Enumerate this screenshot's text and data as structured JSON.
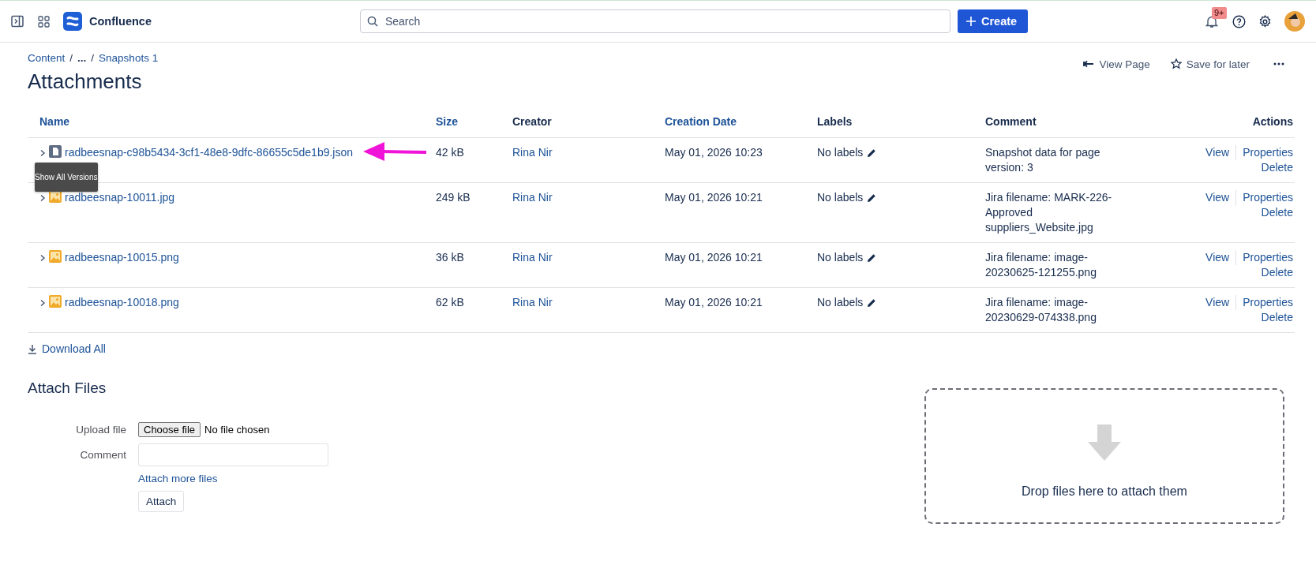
{
  "topbar": {
    "app_name": "Confluence",
    "search": {
      "placeholder": "Search"
    },
    "create_button": "Create",
    "notification_badge": "9+"
  },
  "breadcrumb": {
    "separator": "/",
    "items": [
      "Content",
      "...",
      "Snapshots 1"
    ]
  },
  "page_actions": [
    {
      "kind": "view",
      "label": "View Page"
    },
    {
      "kind": "save",
      "label": "Save for later"
    },
    {
      "kind": "more"
    }
  ],
  "title": "Attachments",
  "table": {
    "columns": [
      {
        "label": "Name",
        "sortable": true
      },
      {
        "label": "Size",
        "sortable": true
      },
      {
        "label": "Creator",
        "sortable": false
      },
      {
        "label": "Creation Date",
        "sortable": true
      },
      {
        "label": "Labels",
        "sortable": false
      },
      {
        "label": "Comment",
        "sortable": false
      },
      {
        "label": "Actions",
        "sortable": false
      }
    ],
    "rows": [
      {
        "kind": "document",
        "name": "radbeesnap-c98b5434-3cf1-48e8-9dfc-86655c5de1b9.json",
        "size": "42 kB",
        "creator": "Rina Nir",
        "date": "May 01, 2026 10:23",
        "labels": "No labels",
        "comment": "Snapshot data for page version: 3",
        "actions": [
          "View",
          "Properties",
          "Delete"
        ],
        "tooltip": "Show All Versions",
        "annotation": {
          "kind": "arrow"
        }
      },
      {
        "kind": "image",
        "name": "radbeesnap-10011.jpg",
        "size": "249 kB",
        "creator": "Rina Nir",
        "date": "May 01, 2026 10:21",
        "labels": "No labels",
        "comment": "Jira filename: MARK-226-Approved suppliers_Website.jpg",
        "actions": [
          "View",
          "Properties",
          "Delete"
        ]
      },
      {
        "kind": "image",
        "name": "radbeesnap-10015.png",
        "size": "36 kB",
        "creator": "Rina Nir",
        "date": "May 01, 2026 10:21",
        "labels": "No labels",
        "comment": "Jira filename: image-20230625-121255.png",
        "actions": [
          "View",
          "Properties",
          "Delete"
        ]
      },
      {
        "kind": "image",
        "name": "radbeesnap-10018.png",
        "size": "62 kB",
        "creator": "Rina Nir",
        "date": "May 01, 2026 10:21",
        "labels": "No labels",
        "comment": "Jira filename: image-20230629-074338.png",
        "actions": [
          "View",
          "Properties",
          "Delete"
        ]
      }
    ]
  },
  "download_all": "Download All",
  "attach_files": {
    "heading": "Attach Files",
    "upload_label": "Upload file",
    "choose_button": "Choose file",
    "no_file": "No file chosen",
    "comment_label": "Comment",
    "more_link": "Attach more files",
    "attach_button": "Attach",
    "drop_zone": "Drop files here to attach them"
  }
}
